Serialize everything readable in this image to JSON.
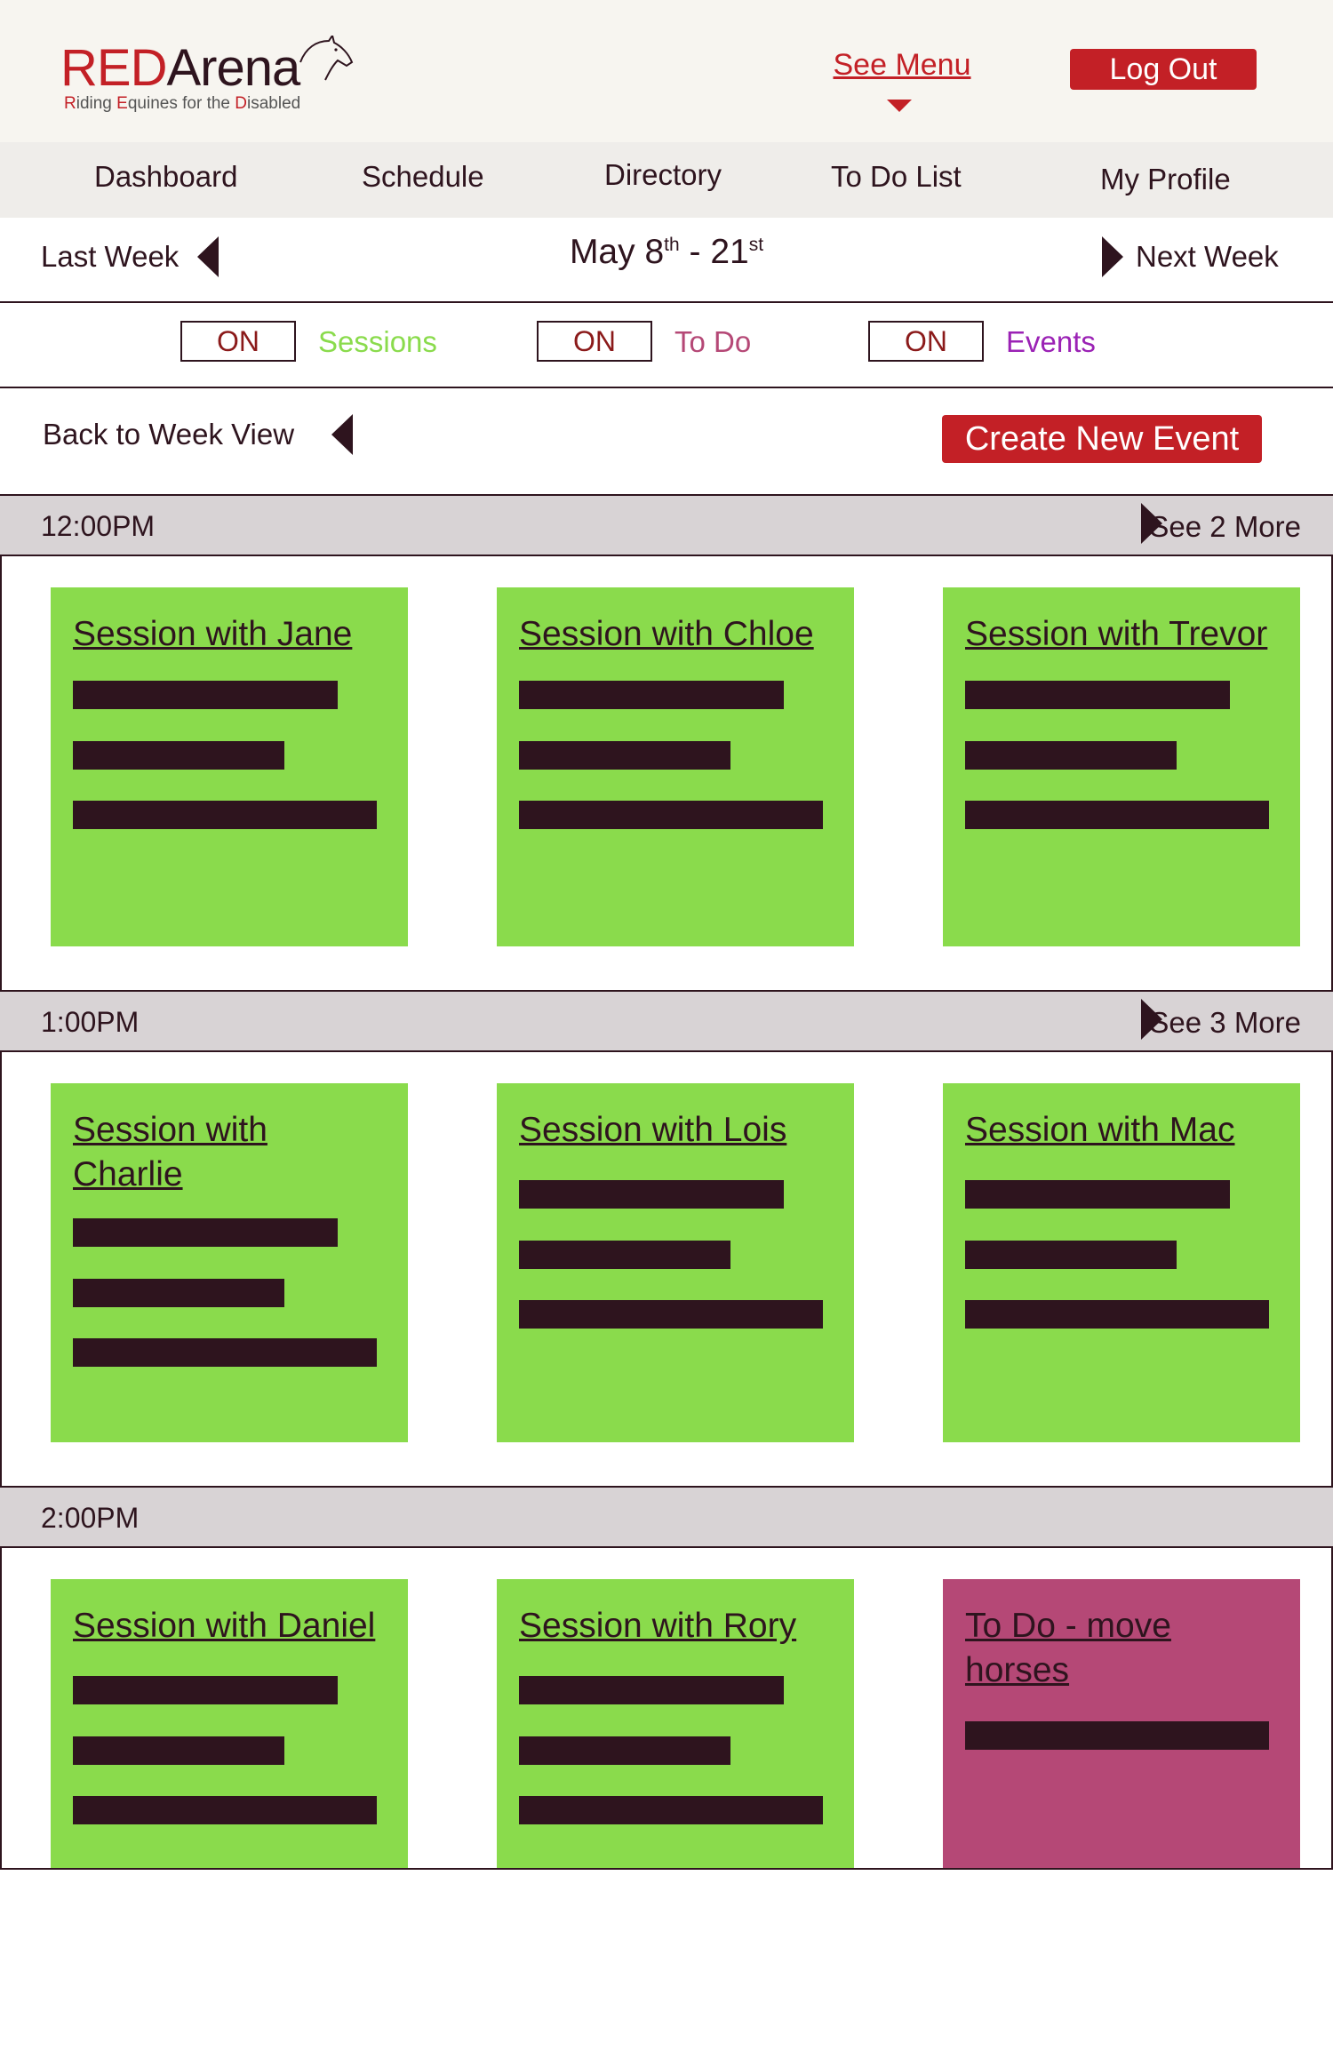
{
  "header": {
    "logo_red": "RED",
    "logo_rest": "Arena",
    "tagline_parts": [
      "R",
      "iding ",
      "E",
      "quines for the ",
      "D",
      "isabled"
    ],
    "see_menu": "See Menu",
    "logout": "Log Out"
  },
  "nav": {
    "items": [
      "Dashboard",
      "Schedule",
      "Directory",
      "To Do List",
      "My Profile"
    ]
  },
  "week": {
    "prev": "Last Week",
    "next": "Next Week",
    "range_start": "May 8",
    "range_start_sup": "th",
    "range_sep": " - 21",
    "range_end_sup": "st"
  },
  "filters": [
    {
      "state": "ON",
      "label": "Sessions",
      "color": "#8adb4c"
    },
    {
      "state": "ON",
      "label": "To Do",
      "color": "#b54876"
    },
    {
      "state": "ON",
      "label": "Events",
      "color": "#9b22b5"
    }
  ],
  "actions": {
    "back": "Back to Week View",
    "create": "Create New Event"
  },
  "schedule": [
    {
      "time": "12:00PM",
      "see_more": "See 2 More",
      "cards": [
        {
          "type": "session",
          "title": "Session with Jane"
        },
        {
          "type": "session",
          "title": "Session with Chloe"
        },
        {
          "type": "session",
          "title": "Session with Trevor"
        }
      ]
    },
    {
      "time": "1:00PM",
      "see_more": "See 3 More",
      "cards": [
        {
          "type": "session",
          "title": "Session with Charlie"
        },
        {
          "type": "session",
          "title": "Session with Lois"
        },
        {
          "type": "session",
          "title": "Session with Mac"
        }
      ]
    },
    {
      "time": "2:00PM",
      "see_more": "",
      "cards": [
        {
          "type": "session",
          "title": "Session with Daniel"
        },
        {
          "type": "session",
          "title": "Session with Rory"
        },
        {
          "type": "todo",
          "title": "To Do - move horses"
        }
      ]
    }
  ],
  "colors": {
    "brand_red": "#c32026",
    "dark": "#2e141e",
    "session_green": "#8adb4c",
    "todo_pink": "#b54876",
    "events_purple": "#9b22b5"
  }
}
